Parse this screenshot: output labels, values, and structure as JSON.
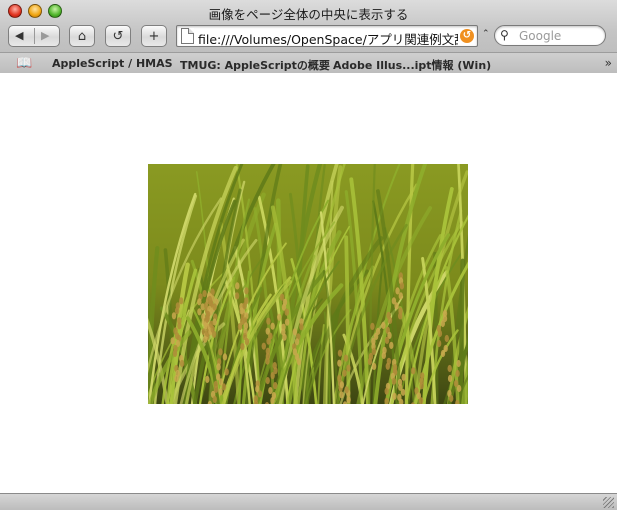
{
  "window": {
    "title": "画像をページ全体の中央に表示する"
  },
  "toolbar": {
    "back_icon": "◀",
    "forward_icon": "▶",
    "home_icon": "⌂",
    "reload_icon": "↺",
    "add_icon": "+",
    "url": "file:///Volumes/OpenSpace/アプリ関連例文辞",
    "search_placeholder": "Google"
  },
  "bookmarks": {
    "items": [
      {
        "label": "AppleScript  /  HMAS"
      },
      {
        "label": "TMUG: AppleScriptの概要"
      },
      {
        "label": "Adobe  Illus...ipt情報  (Win)"
      }
    ]
  },
  "content": {
    "image_description_icon": "rice-field-photo",
    "image_alt": ""
  },
  "colors": {
    "chrome": "#c4c4c4",
    "snap_back": "#f09020"
  }
}
